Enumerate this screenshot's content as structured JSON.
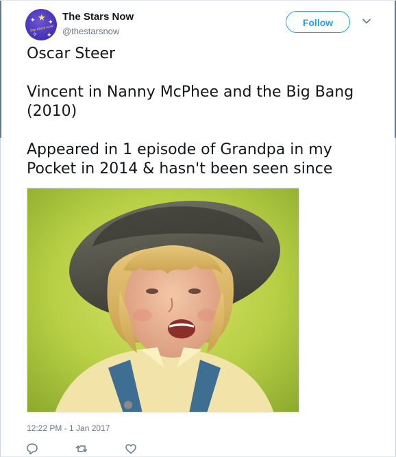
{
  "tweet": {
    "author": {
      "display_name": "The Stars Now",
      "handle": "@thestarsnow",
      "avatar_text": "the stars now"
    },
    "follow_label": "Follow",
    "text_paragraphs": [
      "Oscar Steer",
      "Vincent in Nanny McPhee and the Big Bang (2010)",
      "Appeared in 1 episode of Grandpa in my Pocket in 2014 & hasn't been seen since"
    ],
    "timestamp": "12:22 PM - 1 Jan 2017",
    "actions": [
      "reply-icon",
      "retweet-icon",
      "like-icon"
    ]
  },
  "colors": {
    "accent": "#1da1f2",
    "secondary_text": "#657786",
    "primary_text": "#14171a",
    "avatar_bg": "#4a34b8"
  }
}
